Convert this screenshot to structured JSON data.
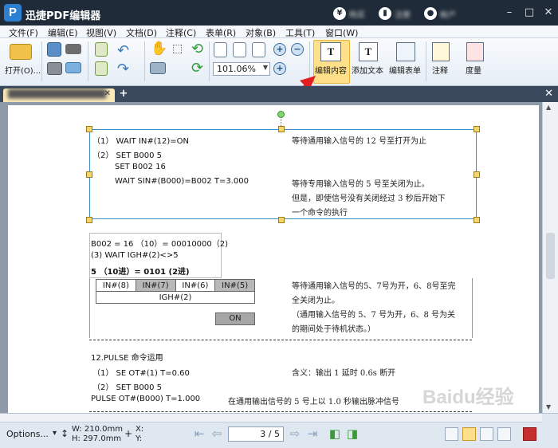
{
  "app": {
    "title": "迅捷PDF编辑器",
    "logo_letter": "P",
    "accounts": [
      {
        "icon": "¥",
        "label": "购买"
      },
      {
        "icon": "▮",
        "label": "注册"
      },
      {
        "icon": "●",
        "label": "帐户"
      }
    ]
  },
  "menu": [
    "文件(F)",
    "编辑(E)",
    "视图(V)",
    "文档(D)",
    "注释(C)",
    "表单(R)",
    "对象(B)",
    "工具(T)",
    "窗口(W)"
  ],
  "toolbar": {
    "open_label": "打开(O)...",
    "zoom_value": "101.06%",
    "edit_content": "编辑内容",
    "add_text": "添加文本",
    "edit_form": "编辑表单",
    "annotate": "注释",
    "measure": "度量"
  },
  "tab": {
    "doc_name": "████████████████"
  },
  "doc": {
    "sel_lines": [
      "（1） WAIT IN#(12)=ON",
      "（2） SET B000 5",
      "SET B002 16",
      "WAIT SIN#(B000)=B002 T=3.000"
    ],
    "sel_notes": [
      "等待通用输入信号的 12 号至打开为止",
      "等待专用输入信号的 5 号至关闭为止。",
      "但是，即使信号没有关闭经过 3 秒后开始下",
      "一个命令的执行"
    ],
    "box2_lines": [
      "B002 = 16 （10）= 00010000（2)",
      "(3) WAIT IGH#(2)<>5",
      "5 （10进）= 0101 (2进)"
    ],
    "sig_table": {
      "heads": [
        "IN#(8)",
        "IN#(7)",
        "IN#(6)",
        "IN#(5)"
      ],
      "row2": "IGH#(2)"
    },
    "on_label": "ON",
    "right_notes": [
      "等待通用输入信号的5、7号为开，6、8号至完",
      "全关闭为止。",
      "（通用输入信号的 5、7 号为开，6、8 号为关",
      "的期间处于待机状态。）"
    ],
    "pulse_title": "12.PULSE 命令运用",
    "pulse_lines": [
      {
        "left": "（1） SE OT#(1)      T=0.60",
        "right": "含义：输出 1 延时 0.6s 断开"
      },
      {
        "left": "（2） SET B000 5",
        "right": ""
      },
      {
        "left": "PULSE OT#(B000) T=1.000",
        "right": "在通用输出信号的 5 号上以 1.0 秒输出脉冲信号"
      }
    ]
  },
  "status": {
    "options": "Options...",
    "width": "W: 210.0mm",
    "height": "H: 297.0mm",
    "x": "X:",
    "y": "Y:",
    "page": "3",
    "page_total": "5"
  },
  "watermark": "Baidu经验"
}
